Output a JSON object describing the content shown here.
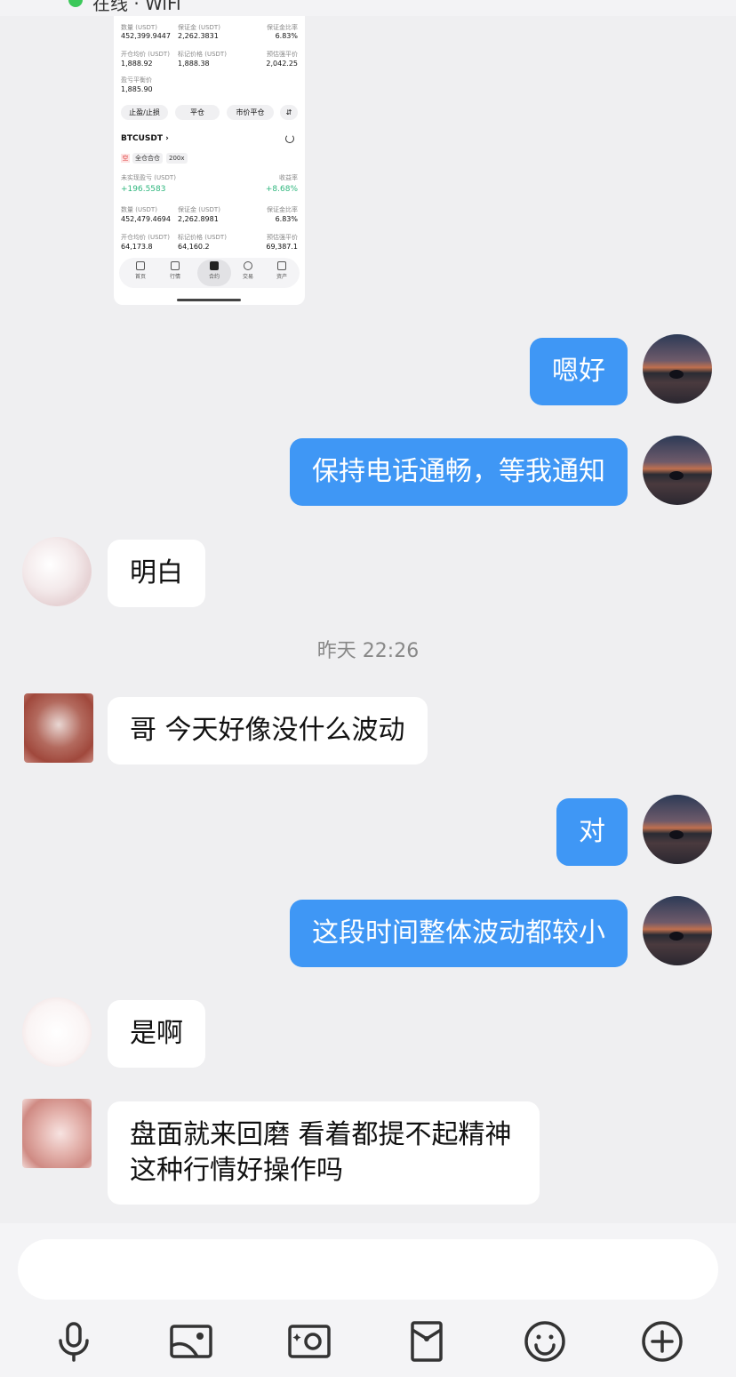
{
  "status": {
    "text": "在线 · WiFi"
  },
  "screenshot": {
    "row1": {
      "labels": [
        "数量 (USDT)",
        "保证金 (USDT)",
        "保证金比率"
      ],
      "values": [
        "452,399.9447",
        "2,262.3831",
        "6.83%"
      ]
    },
    "row2": {
      "labels": [
        "开仓均价 (USDT)",
        "标记价格 (USDT)",
        "预估强平价"
      ],
      "values": [
        "1,888.92",
        "1,888.38",
        "2,042.25"
      ]
    },
    "row3": {
      "label": "盈亏平衡价",
      "value": "1,885.90"
    },
    "actions": [
      "止盈/止损",
      "平仓",
      "市价平仓",
      "⇵"
    ],
    "symbol": "BTCUSDT ›",
    "tag_red": "空",
    "tags": [
      "全仓合仓",
      "200x"
    ],
    "pnl": {
      "label": "未实现盈亏 (USDT)",
      "value": "+196.5583",
      "rate_label": "收益率",
      "rate": "+8.68%"
    },
    "row4": {
      "labels": [
        "数量 (USDT)",
        "保证金 (USDT)",
        "保证金比率"
      ],
      "values": [
        "452,479.4694",
        "2,262.8981",
        "6.83%"
      ]
    },
    "row5": {
      "labels": [
        "开仓均价 (USDT)",
        "标记价格 (USDT)",
        "预估强平价"
      ],
      "values": [
        "64,173.8",
        "64,160.2",
        "69,387.1"
      ]
    },
    "nav": [
      "首页",
      "行情",
      "合约",
      "交易",
      "资产"
    ]
  },
  "messages": [
    {
      "text": "嗯好"
    },
    {
      "text": "保持电话通畅，等我通知"
    },
    {
      "text": "明白"
    },
    {
      "text": "哥 今天好像没什么波动"
    },
    {
      "text": "对"
    },
    {
      "text": "这段时间整体波动都较小"
    },
    {
      "text": "是啊"
    },
    {
      "text": "盘面就来回磨 看着都提不起精神 这种行情好操作吗"
    }
  ],
  "timestamp": "昨天 22:26",
  "input": {
    "placeholder": ""
  },
  "toolbar": {
    "icons": [
      "microphone-icon",
      "image-icon",
      "camera-icon",
      "red-packet-icon",
      "emoji-icon",
      "plus-icon"
    ]
  }
}
